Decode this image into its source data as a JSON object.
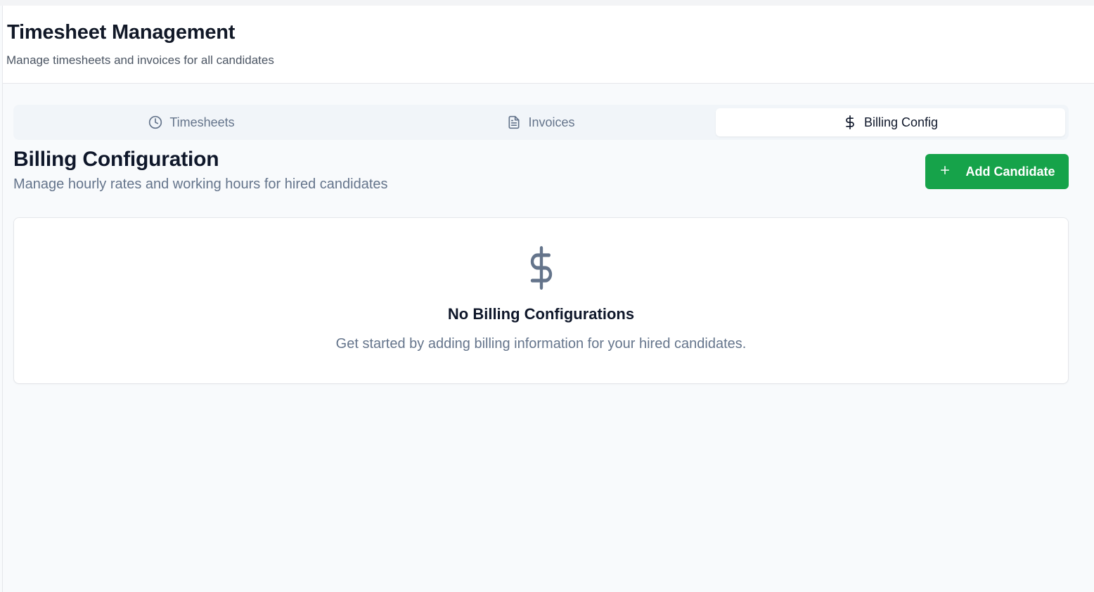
{
  "header": {
    "title": "Timesheet Management",
    "subtitle": "Manage timesheets and invoices for all candidates"
  },
  "tabs": [
    {
      "label": "Timesheets",
      "icon": "clock-icon",
      "active": false
    },
    {
      "label": "Invoices",
      "icon": "file-text-icon",
      "active": false
    },
    {
      "label": "Billing Config",
      "icon": "dollar-icon",
      "active": true
    }
  ],
  "section": {
    "title": "Billing Configuration",
    "subtitle": "Manage hourly rates and working hours for hired candidates",
    "add_button_label": "Add Candidate"
  },
  "empty_state": {
    "icon": "dollar-icon",
    "title": "No Billing Configurations",
    "description": "Get started by adding billing information for your hired candidates."
  },
  "colors": {
    "accent_green": "#16a34a",
    "page_background": "#f8fafc",
    "muted_text": "#64748b"
  }
}
